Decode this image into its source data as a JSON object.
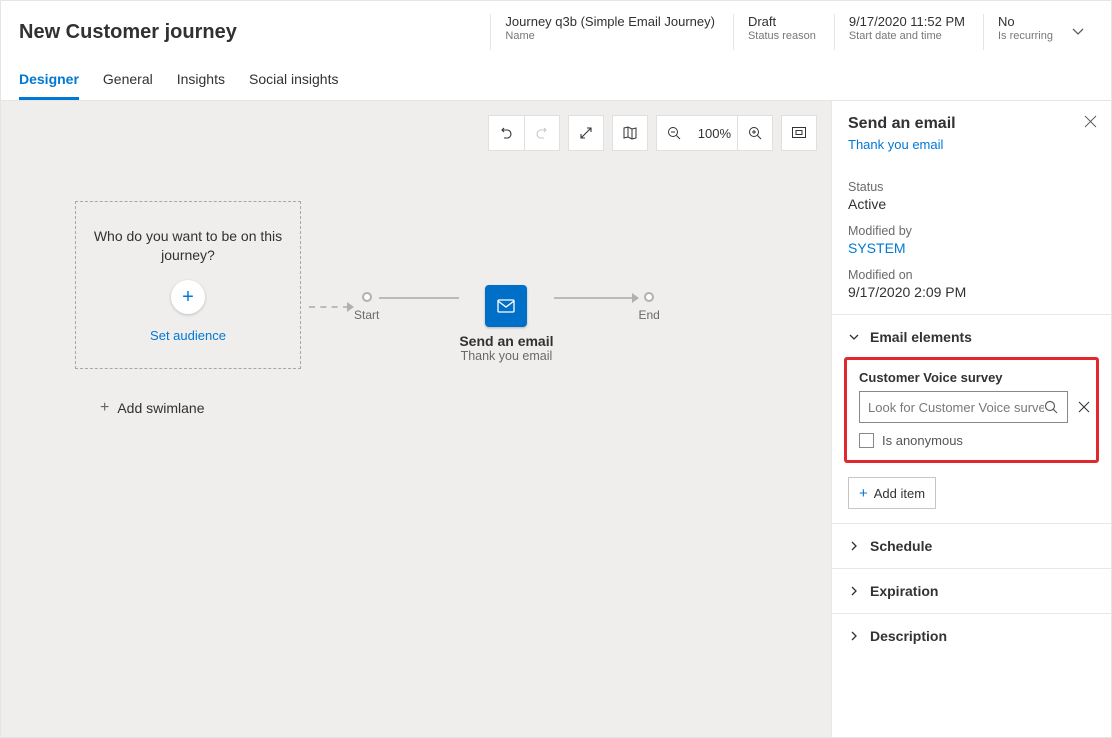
{
  "header": {
    "title": "New Customer journey",
    "meta": {
      "name_val": "Journey q3b (Simple Email Journey)",
      "name_lbl": "Name",
      "status_val": "Draft",
      "status_lbl": "Status reason",
      "start_val": "9/17/2020 11:52 PM",
      "start_lbl": "Start date and time",
      "recur_val": "No",
      "recur_lbl": "Is recurring"
    }
  },
  "tabs": {
    "designer": "Designer",
    "general": "General",
    "insights": "Insights",
    "social": "Social insights"
  },
  "toolbar": {
    "zoom_value": "100%"
  },
  "canvas": {
    "audience_prompt": "Who do you want to be on this journey?",
    "set_audience": "Set audience",
    "start": "Start",
    "end": "End",
    "email_title": "Send an email",
    "email_sub": "Thank you email",
    "add_swimlane": "Add swimlane"
  },
  "panel": {
    "title": "Send an email",
    "link": "Thank you email",
    "status_lbl": "Status",
    "status_val": "Active",
    "modby_lbl": "Modified by",
    "modby_val": "SYSTEM",
    "modon_lbl": "Modified on",
    "modon_val": "9/17/2020 2:09 PM",
    "sections": {
      "email_elements": "Email elements",
      "schedule": "Schedule",
      "expiration": "Expiration",
      "description": "Description"
    },
    "survey": {
      "label": "Customer Voice survey",
      "placeholder": "Look for Customer Voice survey",
      "anon": "Is anonymous"
    },
    "add_item": "Add item"
  }
}
